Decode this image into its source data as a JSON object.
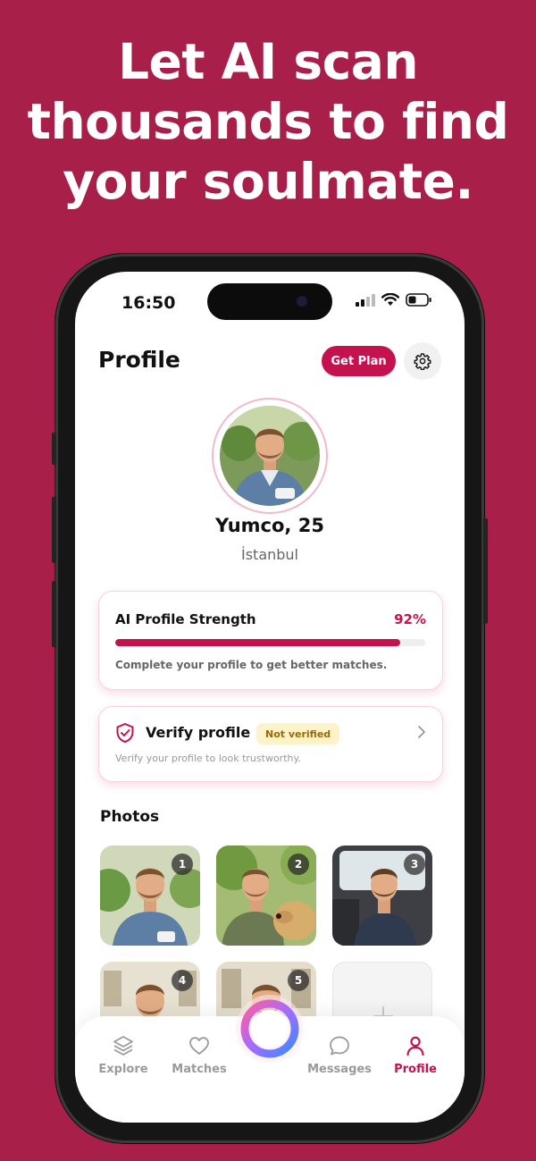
{
  "headline": "Let AI scan thousands to find your soulmate.",
  "status_bar": {
    "time": "16:50"
  },
  "header": {
    "title": "Profile",
    "get_plan_label": "Get Plan"
  },
  "profile": {
    "name_age": "Yumco, 25",
    "city": "İstanbul"
  },
  "strength_card": {
    "title": "AI Profile Strength",
    "percent_label": "92%",
    "progress": 0.92,
    "note": "Complete your profile to get better matches."
  },
  "verify_card": {
    "title": "Verify profile",
    "badge": "Not verified",
    "note": "Verify your profile to look trustworthy."
  },
  "photos": {
    "title": "Photos",
    "items": [
      {
        "number": "1"
      },
      {
        "number": "2"
      },
      {
        "number": "3"
      },
      {
        "number": "4"
      },
      {
        "number": "5"
      }
    ]
  },
  "nav": {
    "items": [
      {
        "label": "Explore",
        "icon": "layers-icon"
      },
      {
        "label": "Matches",
        "icon": "heart-icon"
      },
      {
        "label": "Messages",
        "icon": "chat-bubble-icon"
      },
      {
        "label": "Profile",
        "icon": "person-icon",
        "active": true
      }
    ]
  },
  "colors": {
    "background": "#a8204a",
    "accent": "#c4124f",
    "badge_bg": "#fdf2c8"
  }
}
